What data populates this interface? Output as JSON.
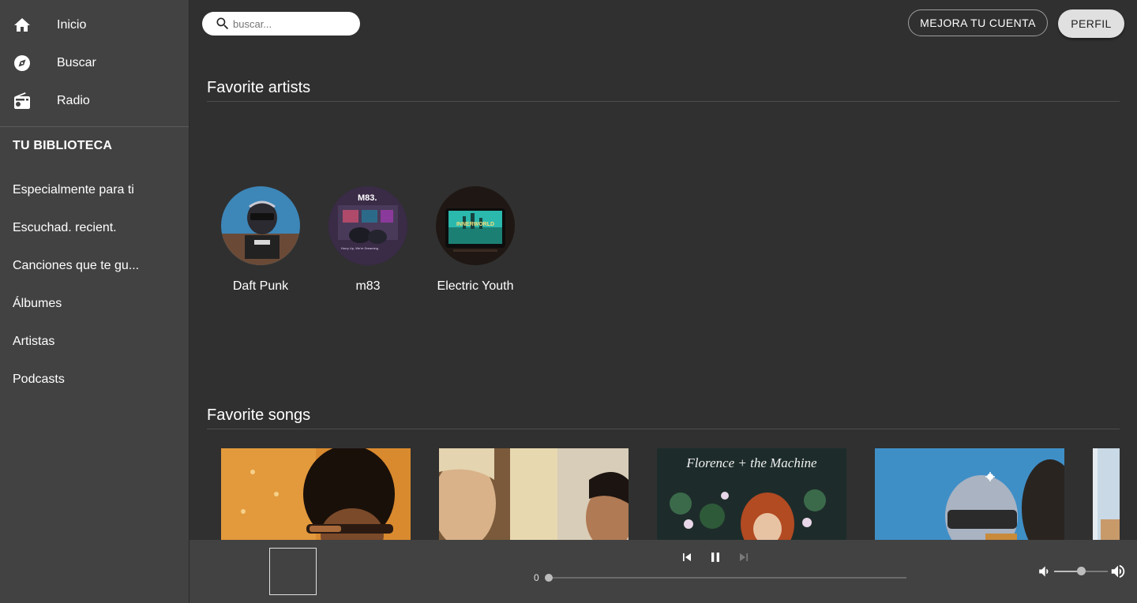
{
  "sidebar": {
    "nav": [
      {
        "label": "Inicio",
        "icon": "home-icon"
      },
      {
        "label": "Buscar",
        "icon": "compass-icon"
      },
      {
        "label": "Radio",
        "icon": "radio-icon"
      }
    ],
    "library_title": "TU BIBLIOTECA",
    "library": [
      {
        "label": "Especialmente para ti"
      },
      {
        "label": "Escuchad. recient."
      },
      {
        "label": "Canciones que te gu..."
      },
      {
        "label": "Álbumes"
      },
      {
        "label": "Artistas"
      },
      {
        "label": "Podcasts"
      }
    ]
  },
  "header": {
    "search_placeholder": "buscar...",
    "upgrade_label": "MEJORA TU CUENTA",
    "profile_label": "PERFIL"
  },
  "favorite_artists": {
    "title": "Favorite artists",
    "items": [
      {
        "name": "Daft Punk"
      },
      {
        "name": "m83"
      },
      {
        "name": "Electric Youth"
      }
    ],
    "m83_cover_text": "M83.",
    "m83_cover_subtext": "Hurry Up, We're Dreaming",
    "electric_youth_cover_text": "INNERWORLD"
  },
  "favorite_songs": {
    "title": "Favorite songs",
    "covers": [
      {
        "name": "portrait-cover-1"
      },
      {
        "name": "portrait-cover-2"
      },
      {
        "name": "florence-cover",
        "text": "Florence + the Machine"
      },
      {
        "name": "daft-punk-cover"
      },
      {
        "name": "partial-cover"
      }
    ]
  },
  "player": {
    "elapsed": "0",
    "progress": 0,
    "volume": 0.5
  },
  "colors": {
    "background": "#303030",
    "sidebar": "#424242",
    "player": "#424242",
    "profile_button": "#e0e0e0"
  }
}
